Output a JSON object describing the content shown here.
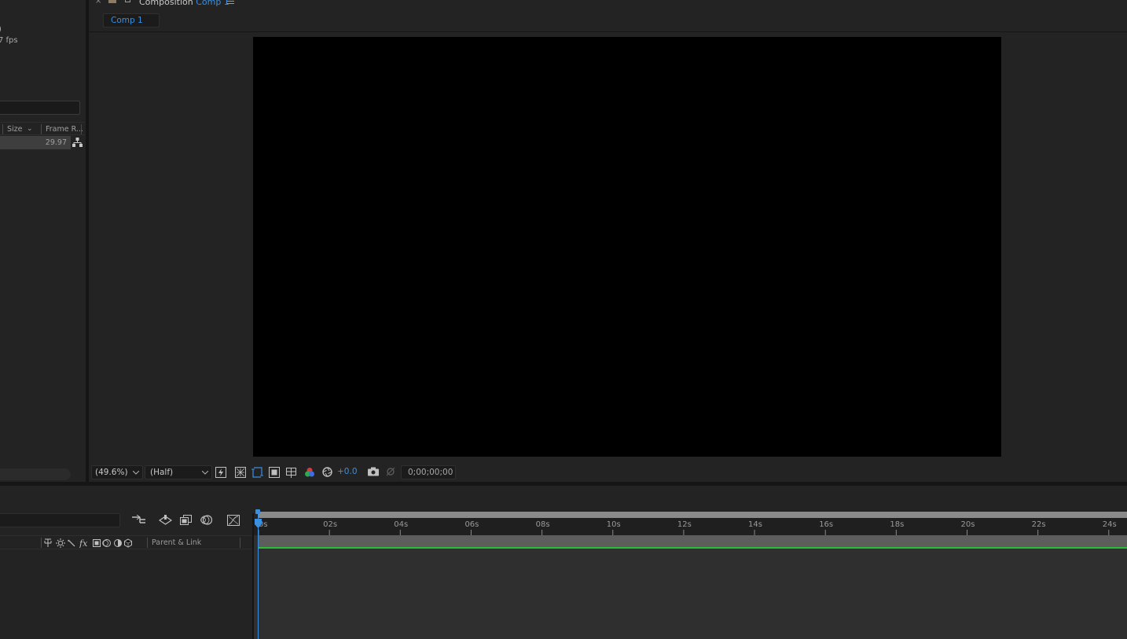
{
  "project": {
    "info_line1": ")",
    "info_line2": "7 fps",
    "columns": {
      "size": "Size",
      "sort_indicator": "⌄",
      "frame_rate": "Frame R..."
    },
    "rows": [
      {
        "frame_rate": "29.97"
      }
    ]
  },
  "composition": {
    "panel_title": "Composition",
    "comp_name": "Comp 1",
    "breadcrumb": "Comp 1",
    "viewer": {
      "zoom": "(49.6%)",
      "resolution": "(Half)",
      "exposure": "+0.0",
      "timecode": "0;00;00;00"
    }
  },
  "timeline": {
    "parent_link_label": "Parent & Link",
    "ruler_labels": [
      "0s",
      "02s",
      "04s",
      "06s",
      "08s",
      "10s",
      "12s",
      "14s",
      "16s",
      "18s",
      "20s",
      "22s",
      "24s"
    ]
  },
  "colors": {
    "accent_blue": "#3a8fe0",
    "layer_duration_green": "#27c035",
    "canvas": "#000000",
    "panel_bg": "#232323"
  }
}
